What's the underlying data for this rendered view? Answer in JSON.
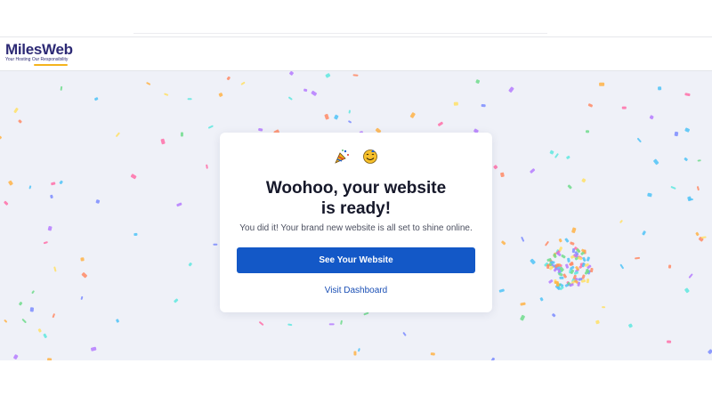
{
  "brand": {
    "name": "MilesWeb",
    "tagline": "Your Hosting Our Responsibility",
    "accent_color": "#f4b31c",
    "brand_color": "#2d2a75"
  },
  "celebration": {
    "icons": [
      "party-popper-icon",
      "smiling-face-icon"
    ],
    "title_line1": "Woohoo, your website",
    "title_line2": "is ready!",
    "subtitle": "You did it! Your brand new website is all set to shine online.",
    "primary_button": "See Your Website",
    "secondary_link": "Visit Dashboard",
    "button_color": "#1358c7",
    "background_color": "#eff1f8"
  }
}
